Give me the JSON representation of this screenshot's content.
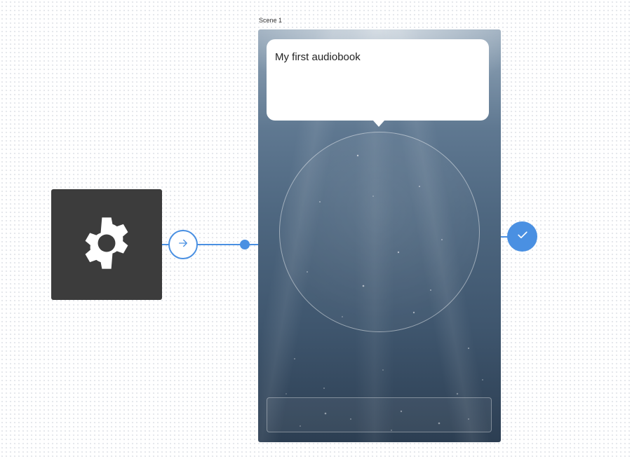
{
  "canvas": {
    "background": "#ffffff",
    "accent_color": "#4a90e2"
  },
  "start_node": {
    "icon": "gear-icon",
    "background": "#3c3c3c"
  },
  "connector": {
    "icon": "arrow-right-icon"
  },
  "scene": {
    "label": "Scene 1",
    "speech_text": "My first audiobook",
    "answer_placeholder": ""
  },
  "end_node": {
    "icon": "checkmark-icon"
  }
}
